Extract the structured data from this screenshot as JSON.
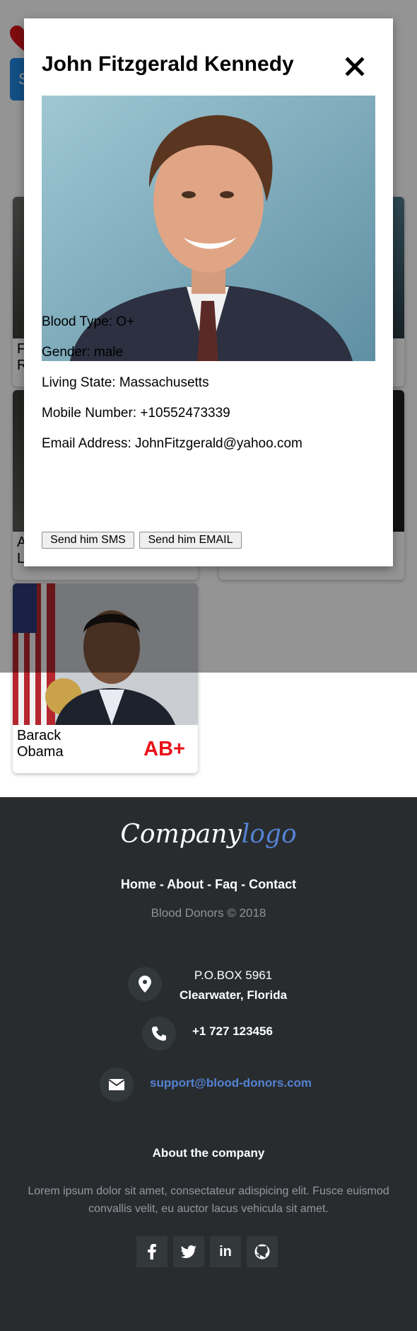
{
  "background": {
    "search_label": "S",
    "cards": [
      {
        "name": "F\nR",
        "blood": ""
      },
      {
        "name": "A\nL",
        "blood": ""
      },
      {
        "name": "Barack\nObama",
        "blood": "AB+"
      }
    ]
  },
  "modal": {
    "title": "John Fitzgerald Kennedy",
    "details": [
      {
        "label": "Blood Type: ",
        "value": "O+"
      },
      {
        "label": "Gender: ",
        "value": "male"
      },
      {
        "label": "Living State: ",
        "value": "Massachusetts"
      },
      {
        "label": "Mobile Number: ",
        "value": "+10552473339"
      },
      {
        "label": "Email Address: ",
        "value": "JohnFitzgerald@yahoo.com"
      }
    ],
    "sms_button": "Send him SMS",
    "email_button": "Send him EMAIL"
  },
  "footer": {
    "logo_part1": "Company",
    "logo_part2": "logo",
    "links": [
      "Home",
      "About",
      "Faq",
      "Contact"
    ],
    "separator": " - ",
    "copyright": "Blood Donors © 2018",
    "address_line1": "P.O.BOX 5961",
    "address_line2": "Clearwater, Florida",
    "phone": "+1 727 123456",
    "email": "support@blood-donors.com",
    "about_heading": "About the company",
    "about_text": "Lorem ipsum dolor sit amet, consectateur adispicing elit. Fusce euismod convallis velit, eu auctor lacus vehicula sit amet.",
    "social": [
      "facebook-icon",
      "twitter-icon",
      "linkedin-icon",
      "github-icon"
    ]
  },
  "colors": {
    "blood_red": "#e8121a",
    "accent_blue": "#5383d3",
    "footer_bg": "#292c2f"
  }
}
